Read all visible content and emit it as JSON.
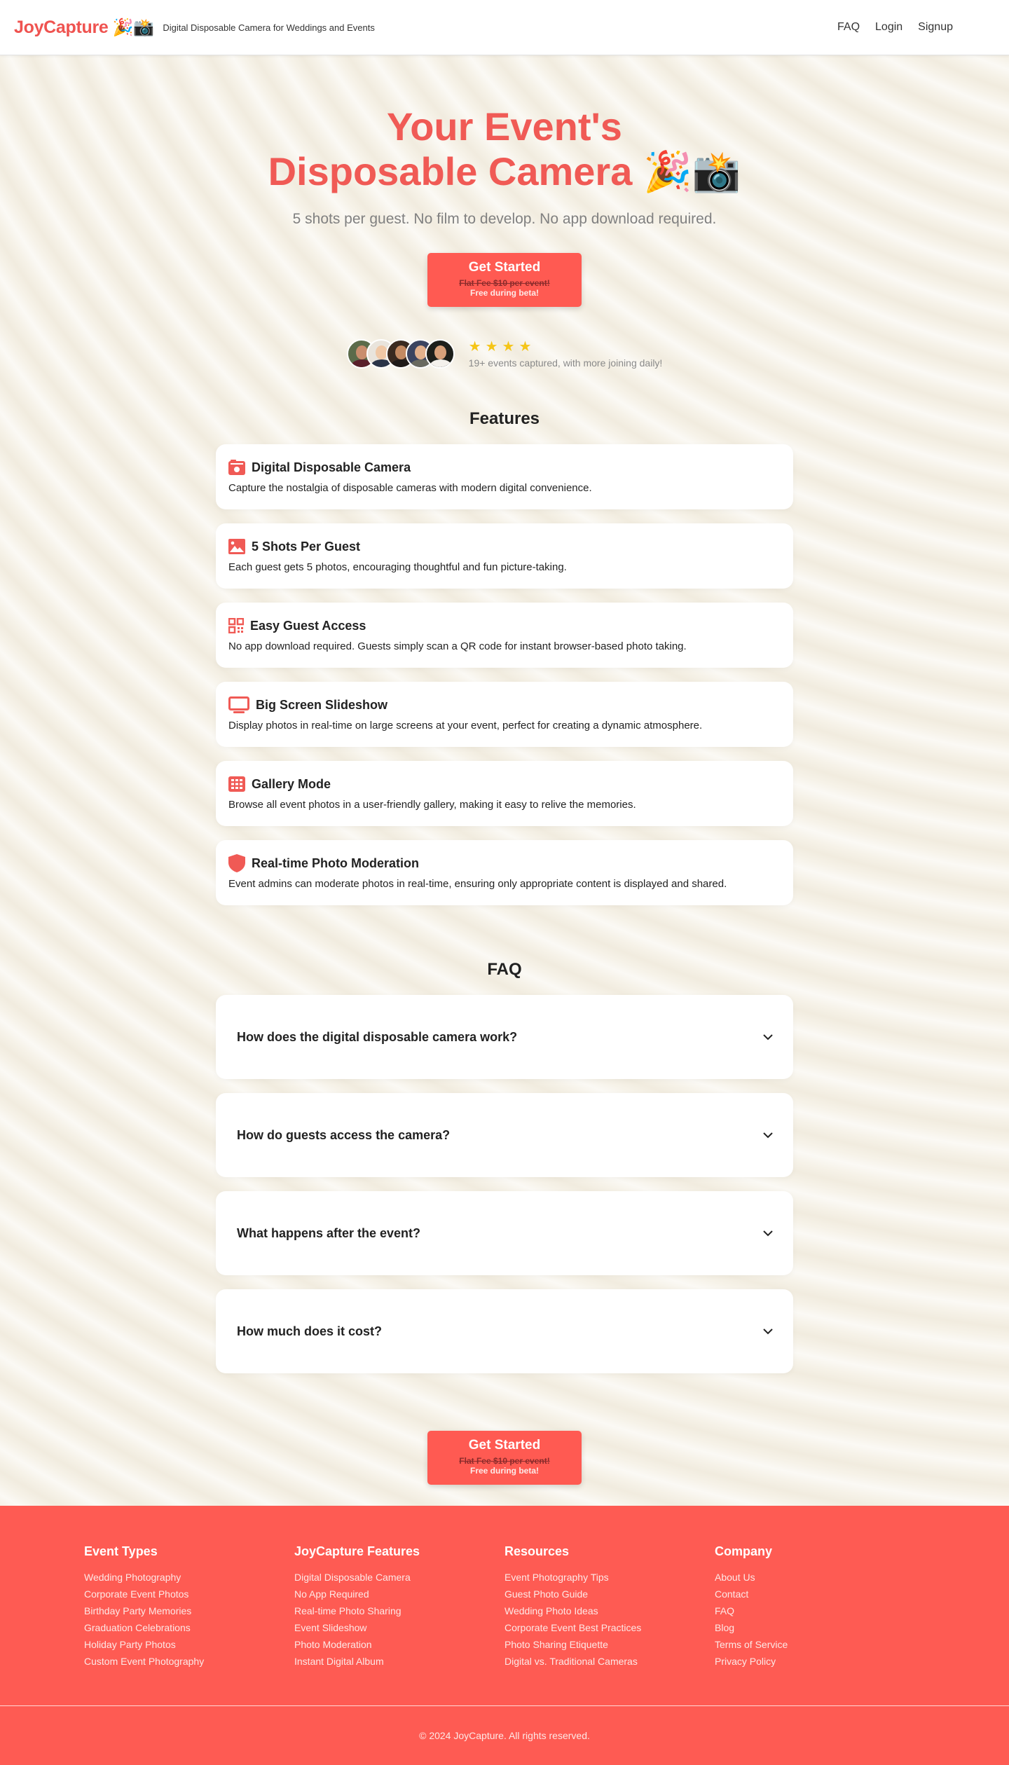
{
  "header": {
    "logo": "JoyCapture",
    "logo_emoji": "🎉📸",
    "tagline": "Digital Disposable Camera for Weddings and Events",
    "nav": [
      "FAQ",
      "Login",
      "Signup"
    ]
  },
  "hero": {
    "title_line1": "Your Event's",
    "title_line2": "Disposable Camera",
    "title_emoji": "🎉📸",
    "subtitle": "5 shots per guest. No film to develop. No app download required.",
    "cta": {
      "label": "Get Started",
      "old_price": "Flat Fee $10 per event!",
      "promo": "Free during beta!"
    },
    "social_proof": {
      "stars": "★★★★",
      "rating_stars": 4,
      "caption": "19+ events captured, with more joining daily!",
      "avatar_count": 5
    }
  },
  "features": {
    "title": "Features",
    "items": [
      {
        "icon": "camera-icon",
        "title": "Digital Disposable Camera",
        "desc": "Capture the nostalgia of disposable cameras with modern digital convenience."
      },
      {
        "icon": "image-icon",
        "title": "5 Shots Per Guest",
        "desc": "Each guest gets 5 photos, encouraging thoughtful and fun picture-taking."
      },
      {
        "icon": "qr-code-icon",
        "title": "Easy Guest Access",
        "desc": "No app download required. Guests simply scan a QR code for instant browser-based photo taking."
      },
      {
        "icon": "monitor-icon",
        "title": "Big Screen Slideshow",
        "desc": "Display photos in real-time on large screens at your event, perfect for creating a dynamic atmosphere."
      },
      {
        "icon": "grid-icon",
        "title": "Gallery Mode",
        "desc": "Browse all event photos in a user-friendly gallery, making it easy to relive the memories."
      },
      {
        "icon": "shield-icon",
        "title": "Real-time Photo Moderation",
        "desc": "Event admins can moderate photos in real-time, ensuring only appropriate content is displayed and shared."
      }
    ]
  },
  "faq": {
    "title": "FAQ",
    "items": [
      "How does the digital disposable camera work?",
      "How do guests access the camera?",
      "What happens after the event?",
      "How much does it cost?"
    ]
  },
  "bottom_cta": {
    "label": "Get Started",
    "old_price": "Flat Fee $10 per event!",
    "promo": "Free during beta!"
  },
  "footer": {
    "columns": [
      {
        "title": "Event Types",
        "links": [
          "Wedding Photography",
          "Corporate Event Photos",
          "Birthday Party Memories",
          "Graduation Celebrations",
          "Holiday Party Photos",
          "Custom Event Photography"
        ]
      },
      {
        "title": "JoyCapture Features",
        "links": [
          "Digital Disposable Camera",
          "No App Required",
          "Real-time Photo Sharing",
          "Event Slideshow",
          "Photo Moderation",
          "Instant Digital Album"
        ]
      },
      {
        "title": "Resources",
        "links": [
          "Event Photography Tips",
          "Guest Photo Guide",
          "Wedding Photo Ideas",
          "Corporate Event Best Practices",
          "Photo Sharing Etiquette",
          "Digital vs. Traditional Cameras"
        ]
      },
      {
        "title": "Company",
        "links": [
          "About Us",
          "Contact",
          "FAQ",
          "Blog",
          "Terms of Service",
          "Privacy Policy"
        ]
      }
    ],
    "copyright": "© 2024 JoyCapture. All rights reserved."
  },
  "colors": {
    "brand": "#ef5350",
    "cta": "#ff5a52",
    "footer": "#fe5b53",
    "star": "#f5c518"
  }
}
